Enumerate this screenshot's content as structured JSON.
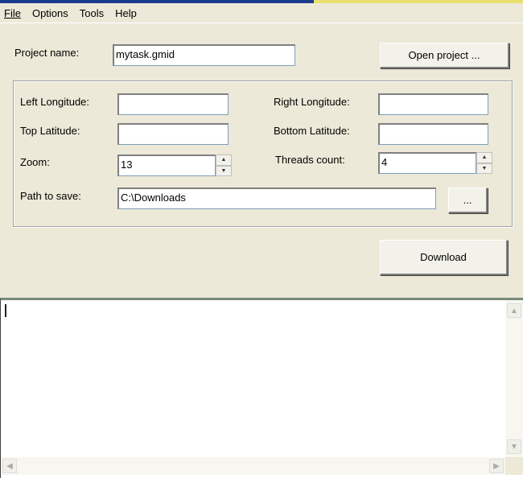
{
  "menu": {
    "file": "File",
    "options": "Options",
    "tools": "Tools",
    "help": "Help"
  },
  "project": {
    "label": "Project name:",
    "value": "mytask.gmid",
    "open_button": "Open project ..."
  },
  "fields": {
    "left_longitude": {
      "label": "Left Longitude:",
      "value": ""
    },
    "right_longitude": {
      "label": "Right Longitude:",
      "value": ""
    },
    "top_latitude": {
      "label": "Top Latitude:",
      "value": ""
    },
    "bottom_latitude": {
      "label": "Bottom Latitude:",
      "value": ""
    },
    "zoom": {
      "label": "Zoom:",
      "value": "13"
    },
    "threads": {
      "label": "Threads count:",
      "value": "4"
    },
    "path": {
      "label": "Path to save:",
      "value": "C:\\Downloads",
      "browse_button": "..."
    }
  },
  "download_button": "Download",
  "log": {
    "value": ""
  }
}
